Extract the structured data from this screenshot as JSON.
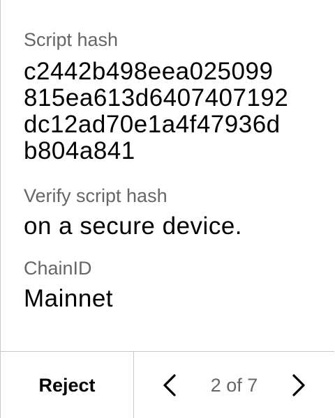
{
  "fields": {
    "script_hash": {
      "label": "Script hash",
      "value_lines": [
        "c2442b498eea025099",
        "815ea613d6407407192",
        "dc12ad70e1a4f47936d",
        "b804a841"
      ]
    },
    "verify": {
      "label": "Verify script hash",
      "value": "on a secure device."
    },
    "chain": {
      "label": "ChainID",
      "value": "Mainnet"
    }
  },
  "footer": {
    "reject_label": "Reject",
    "page_indicator": "2 of 7",
    "prev_icon": "chevron-left-icon",
    "next_icon": "chevron-right-icon"
  }
}
